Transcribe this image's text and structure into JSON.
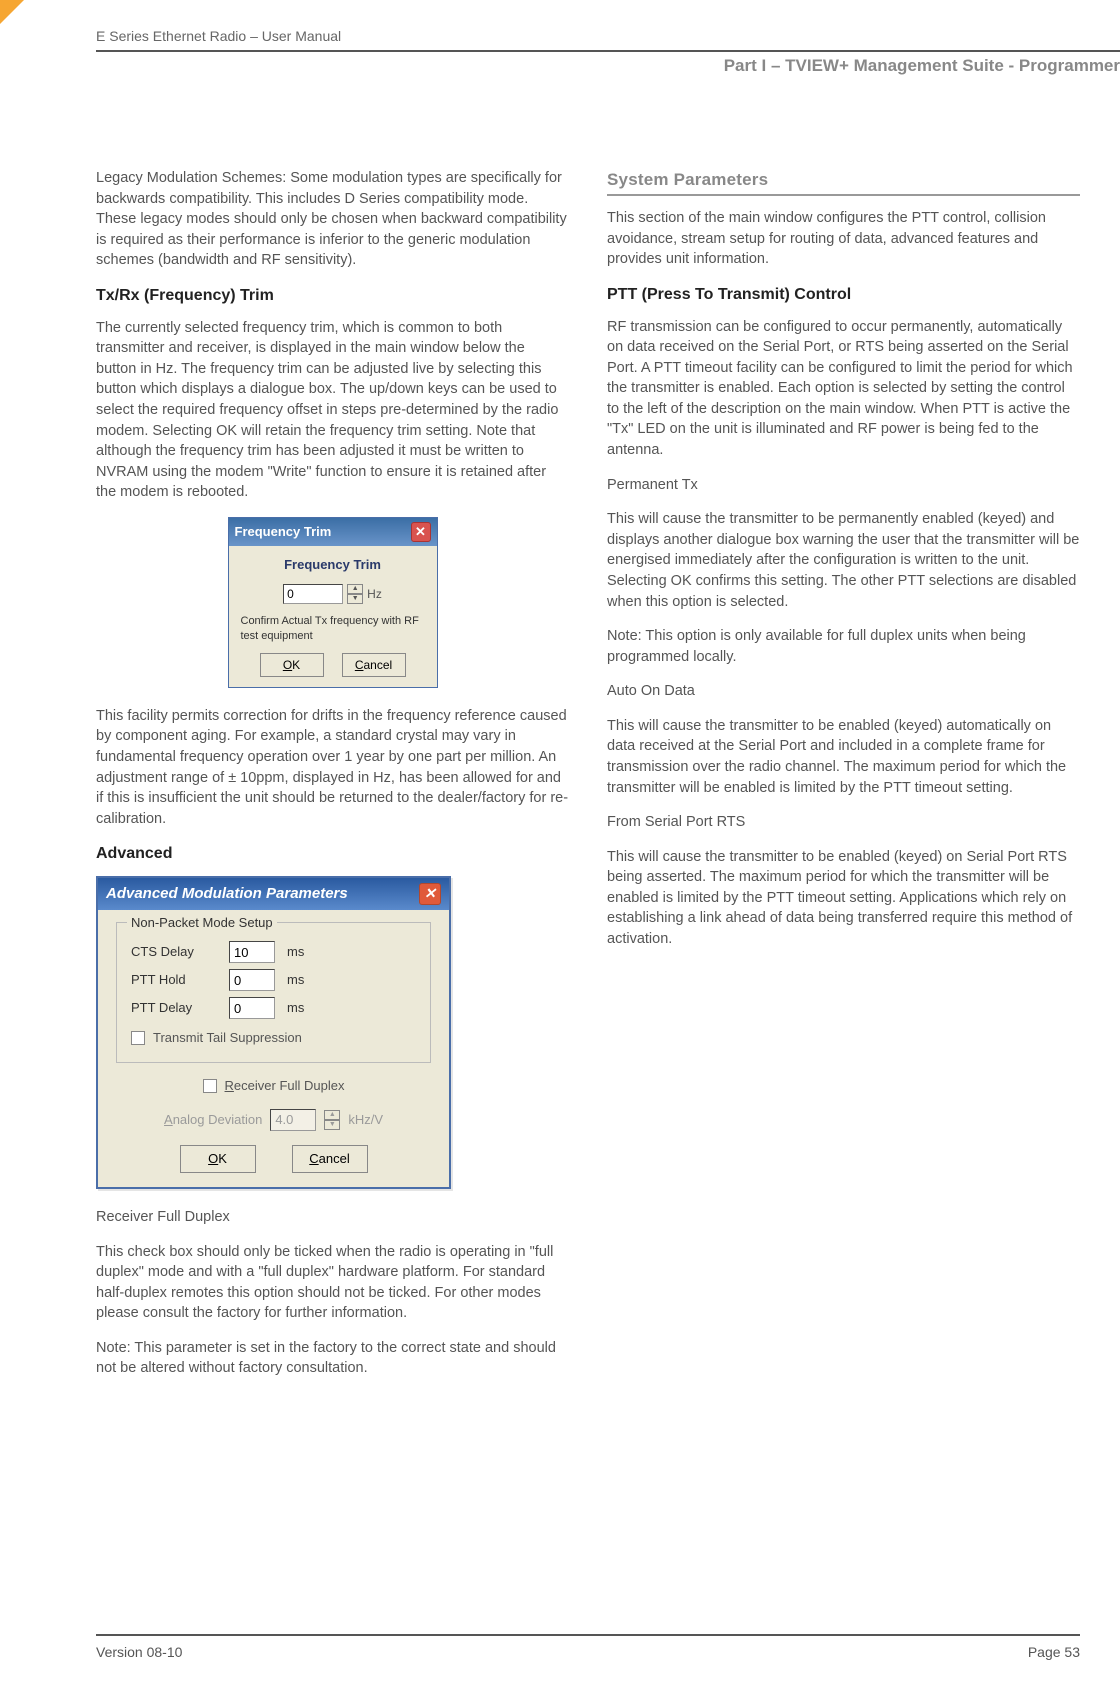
{
  "header": {
    "doc_title": "E Series Ethernet Radio – User Manual",
    "part_title": "Part I – TVIEW+ Management Suite - Programmer"
  },
  "left": {
    "legacy_para": "Legacy Modulation Schemes: Some modulation types are specifically for backwards compatibility. This includes D Series compatibility mode. These legacy modes should only be chosen when backward compatibility is required as their performance is inferior to the generic modulation schemes (bandwidth and RF sensitivity).",
    "h_txrx": "Tx/Rx (Frequency) Trim",
    "txrx_p1": "The currently selected frequency trim, which is common to both transmitter and receiver, is displayed in the main window below the button in Hz. The frequency trim can be adjusted live by selecting this button which displays a dialogue box. The up/down keys can be used to select the required frequency offset in steps pre-determined by the radio modem. Selecting OK will retain the frequency trim setting. Note that although the frequency trim has been adjusted it must be written to NVRAM using the modem \"Write\" function to ensure it is retained after the modem is rebooted.",
    "ft_dialog": {
      "title": "Frequency Trim",
      "label": "Frequency Trim",
      "value": "0",
      "unit": "Hz",
      "hint": "Confirm Actual Tx frequency with RF test equipment",
      "ok": "OK",
      "cancel": "Cancel"
    },
    "txrx_p2": "This facility permits correction for drifts in the frequency reference caused by component aging.  For example, a standard crystal may vary in fundamental frequency operation over 1 year by one part per million. An adjustment range of ± 10ppm, displayed in Hz, has been allowed for and if this is insufficient the unit should be returned to the dealer/factory for re-calibration.",
    "h_adv": "Advanced",
    "adv_dialog": {
      "title": "Advanced Modulation Parameters",
      "nonpacket_legend": "Non-Packet Mode Setup",
      "rows": {
        "cts_label": "CTS Delay",
        "cts_value": "10",
        "ptt_hold_label": "PTT Hold",
        "ptt_hold_value": "0",
        "ptt_delay_label": "PTT Delay",
        "ptt_delay_value": "0",
        "unit": "ms"
      },
      "tts_label": "Transmit Tail Suppression",
      "rfd_label": "Receiver Full Duplex",
      "analog_label": "Analog Deviation",
      "analog_value": "4.0",
      "analog_unit": "kHz/V",
      "ok": "OK",
      "cancel": "Cancel"
    },
    "rfd_h": "Receiver Full Duplex",
    "rfd_p1": "This check box should only be ticked when the radio is operating in \"full duplex\" mode and with a \"full duplex\" hardware platform. For standard half-duplex remotes this option should not be ticked. For other modes please consult the factory for further information.",
    "rfd_p2": "Note: This parameter is set in the factory to the correct state and should not be altered without factory consultation."
  },
  "right": {
    "h_sys": "System Parameters",
    "sys_p1": "This section of the main window configures the PTT control, collision avoidance, stream setup for routing of data, advanced features and provides unit information.",
    "h_ptt": "PTT (Press To Transmit) Control",
    "ptt_p1": "RF transmission can be configured to occur permanently, automatically on data received on the Serial Port, or RTS being asserted on the Serial Port. A PTT timeout facility can be configured to limit the period for which the transmitter is enabled. Each option is selected by setting the control to the left of the description on the main window. When PTT is active the \"Tx\" LED on the unit is illuminated and RF power is being fed to the antenna.",
    "perm_h": "Permanent Tx",
    "perm_p": "This will cause the transmitter to be permanently enabled (keyed) and displays another dialogue box warning the user that the transmitter will be energised immediately after the configuration is written to the unit. Selecting OK confirms this setting. The other PTT selections are disabled when this option is selected.",
    "perm_note": "Note: This option is only available for full duplex units when being programmed locally.",
    "auto_h": "Auto On Data",
    "auto_p": "This will cause the transmitter to be enabled (keyed) automatically on data received at the Serial Port and included in a complete frame for transmission over the radio channel. The maximum period for which the transmitter will be enabled is limited by the PTT timeout setting.",
    "rts_h": "From Serial Port RTS",
    "rts_p": "This will cause the transmitter to be enabled (keyed) on Serial Port RTS being asserted. The maximum period for which the transmitter will be enabled is limited by the PTT timeout setting. Applications which rely on establishing a link ahead of data being transferred require this method of activation."
  },
  "footer": {
    "version": "Version 08-10",
    "page": "Page 53"
  }
}
